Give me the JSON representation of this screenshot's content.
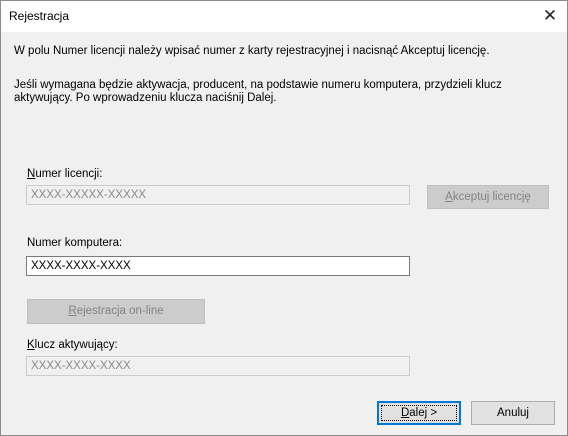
{
  "window": {
    "title": "Rejestracja",
    "close_glyph": "✕"
  },
  "instructions": {
    "line1": "W polu Numer licencji należy wpisać numer z karty rejestracyjnej i nacisnąć Akceptuj licencję.",
    "line2": "Jeśli wymagana będzie aktywacja, producent, na podstawie numeru komputera, przydzieli klucz",
    "line3": "aktywujący. Po wprowadzeniu klucza naciśnij Dalej."
  },
  "license": {
    "label_mnemonic": "N",
    "label_rest": "umer licencji:",
    "value": "XXXX-XXXXX-XXXXX",
    "accept_mnemonic": "A",
    "accept_rest": "kceptuj licencję"
  },
  "computer": {
    "label": "Numer komputera:",
    "value": "XXXX-XXXX-XXXX"
  },
  "online": {
    "button_mnemonic": "R",
    "button_rest": "ejestracja on-line"
  },
  "activation": {
    "label_mnemonic": "K",
    "label_rest": "lucz aktywujący:",
    "value": "XXXX-XXXX-XXXX"
  },
  "footer": {
    "next_mnemonic": "D",
    "next_rest": "alej >",
    "cancel_label": "Anuluj"
  },
  "colors": {
    "default_button_border": "#0078d7",
    "disabled_text": "#8a8a8a"
  }
}
